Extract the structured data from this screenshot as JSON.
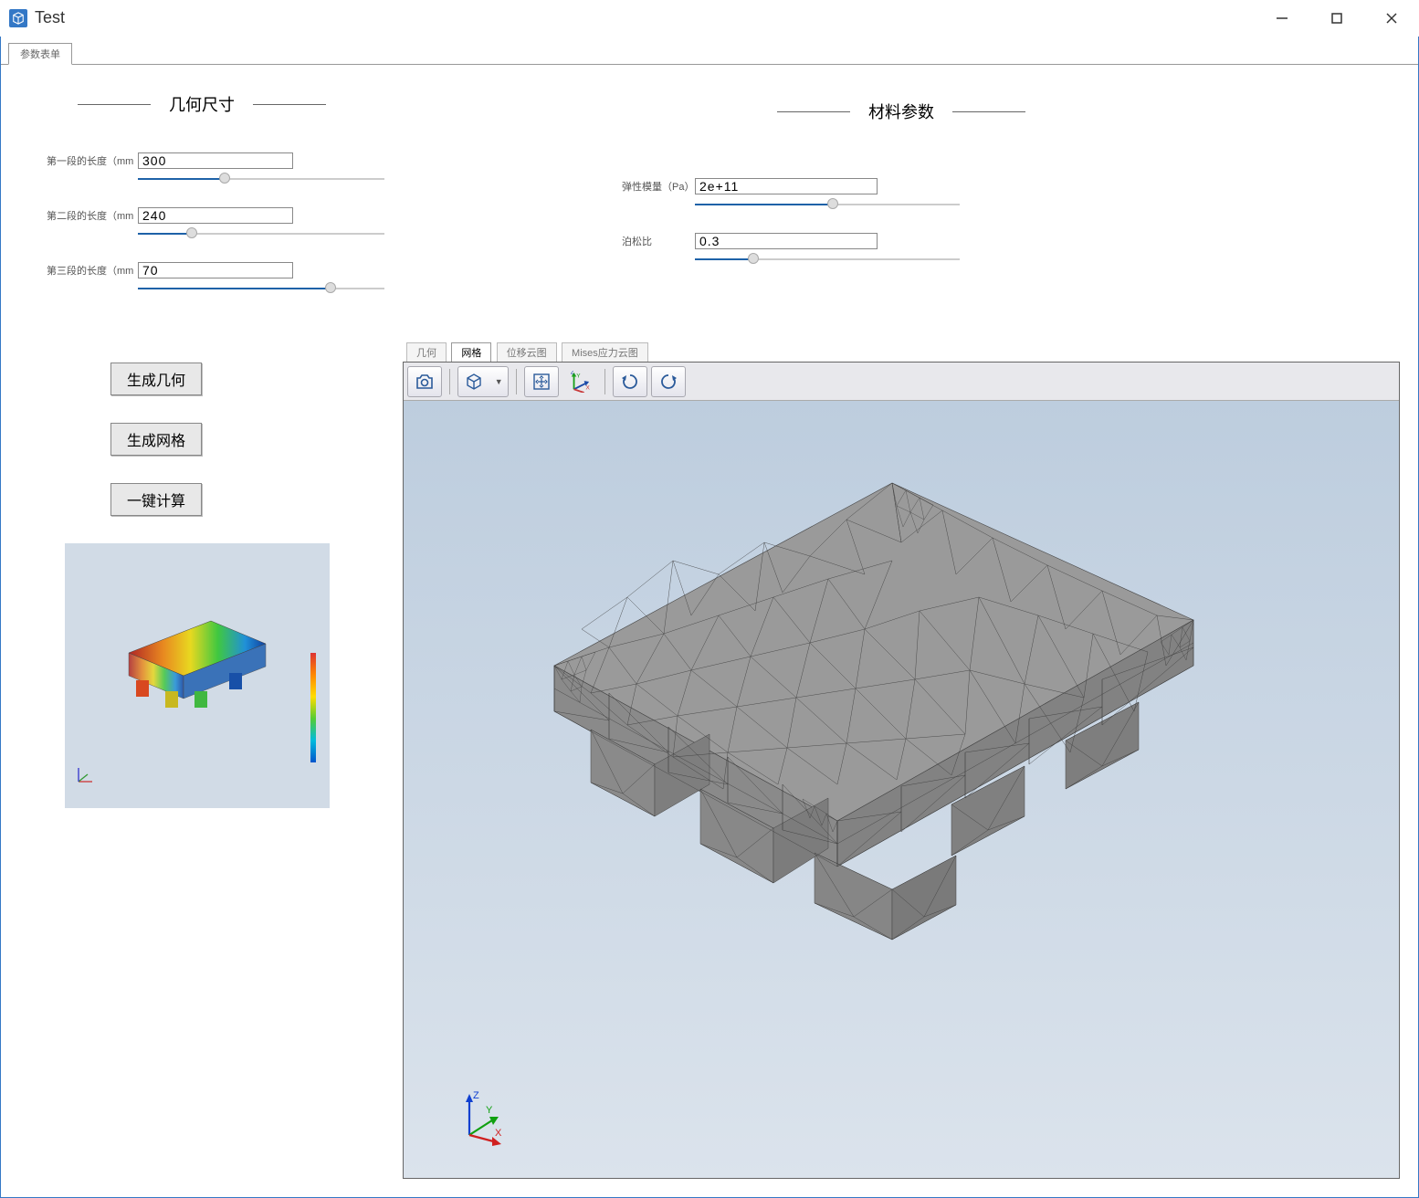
{
  "window": {
    "title": "Test"
  },
  "main_tab": "参数表单",
  "sections": {
    "geometry": "几何尺寸",
    "material": "材料参数"
  },
  "geometry_params": [
    {
      "label": "第一段的长度（mm",
      "value": "300",
      "fill": 35
    },
    {
      "label": "第二段的长度（mm",
      "value": "240",
      "fill": 22
    },
    {
      "label": "第三段的长度（mm",
      "value": "70",
      "fill": 78
    }
  ],
  "material_params": [
    {
      "label": "弹性模量（Pa）",
      "value": "2e+11",
      "fill": 52
    },
    {
      "label": "泊松比",
      "value": "0.3",
      "fill": 22
    }
  ],
  "actions": {
    "gen_geometry": "生成几何",
    "gen_mesh": "生成网格",
    "compute": "一键计算"
  },
  "viewer_tabs": [
    "几何",
    "网格",
    "位移云图",
    "Mises应力云图"
  ],
  "viewer_active_tab": 1,
  "axis_labels": {
    "x": "X",
    "y": "Y",
    "z": "Z"
  },
  "preview_caption": ""
}
